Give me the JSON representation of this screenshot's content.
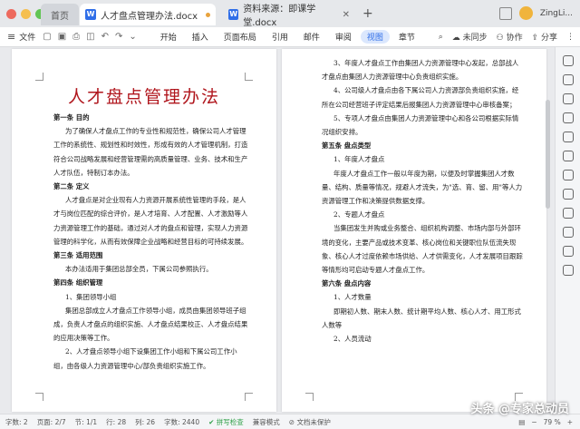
{
  "titlebar": {
    "home_tab": "首页",
    "doc_tab_active": "人才盘点管理办法.docx",
    "doc_tab_2": "资料来源：即课学堂.docx",
    "user": "ZingLi..."
  },
  "menubar": {
    "file": "文件",
    "items": [
      "开始",
      "插入",
      "页面布局",
      "引用",
      "邮件",
      "审阅",
      "视图",
      "章节"
    ],
    "active": "视图",
    "unsynced": "未同步",
    "collab": "协作",
    "share": "分享"
  },
  "page1": {
    "title": "人才盘点管理办法",
    "lines": [
      {
        "t": "第一条 目的",
        "k": "h"
      },
      {
        "t": "为了确保人才盘点工作的专业性和规范性，确保公司人才管理工作的系统性、规划性和时效性，形成有效的人才管理机制，打造符合公司战略发展和经营管理需的高质量管理、业务、技术和生产人才队伍，特制订本办法。",
        "k": "pi"
      },
      {
        "t": "第二条 定义",
        "k": "h"
      },
      {
        "t": "人才盘点是对企业现有人力资源开展系统性管理的手段，是人才与岗位匹配的综合评价，是人才培育、人才配置、人才激励等人力资源管理工作的基础，通过对人才的盘点和管理，实现人力资源管理的科学化，从而有效保障企业战略和经营目标的可持续发展。",
        "k": "pi"
      },
      {
        "t": "第三条 适用范围",
        "k": "h"
      },
      {
        "t": "本办法适用于集团总部全员，下属公司参照执行。",
        "k": "pi"
      },
      {
        "t": "第四条 组织管理",
        "k": "h"
      },
      {
        "t": "1、集团领导小组",
        "k": "li"
      },
      {
        "t": "集团总部成立人才盘点工作领导小组，成员由集团领导班子组成，负责人才盘点的组织实施、人才盘点结果校正、人才盘点结果的应用决策等工作。",
        "k": "pi"
      },
      {
        "t": "2、人才盘点领导小组下设集团工作小组和下属公司工作小组，由各级人力资源管理中心/部负责组织实施工作。",
        "k": "pi"
      }
    ]
  },
  "page2": {
    "lines": [
      {
        "t": "3、年度人才盘点工作由集团人力资源管理中心发起，总部战人才盘点由集团人力资源管理中心负责组织实施。",
        "k": "pi"
      },
      {
        "t": "4、公司级人才盘点由各下属公司人力资源部负责组织实施，经所在公司经营班子评定结果后报集团人力资源管理中心审核备案；",
        "k": "pi"
      },
      {
        "t": "5、专项人才盘点由集团人力资源管理中心和各公司根据实际情况组织安排。",
        "k": "pi"
      },
      {
        "t": "第五条 盘点类型",
        "k": "h"
      },
      {
        "t": "1、年度人才盘点",
        "k": "li"
      },
      {
        "t": "年度人才盘点工作一般以年度为期，以便及时掌握集团人才数量、结构、质量等情况，规避人才流失，为\"选、育、留、用\"等人力资源管理工作和决策提供数据支撑。",
        "k": "pi"
      },
      {
        "t": "2、专题人才盘点",
        "k": "li"
      },
      {
        "t": "当集团发生并购或业务整合、组织机构调整、市场内部与外部环境的变化，主要产品或技术变革、核心岗位和关键职位队伍流失现象、核心人才过度依赖市场供给、人才供需变化，人才发展项目跟踪等情形均可启动专题人才盘点工作。",
        "k": "pi"
      },
      {
        "t": "第六条 盘点内容",
        "k": "h"
      },
      {
        "t": "1、人才数量",
        "k": "li"
      },
      {
        "t": "即期初人数、期末人数、统计期平均人数、核心人才、用工形式人数等",
        "k": "pi"
      },
      {
        "t": "2、人员流动",
        "k": "li"
      }
    ]
  },
  "status": {
    "words": "字数: 2",
    "page": "页面: 2/7",
    "line": "节: 1/1",
    "row": "行: 28",
    "col": "列: 26",
    "count": "字数: 2440",
    "spell": "拼写检查",
    "compat": "兼容模式",
    "protect": "文档未保护",
    "zoom": "79 %"
  },
  "watermark": "头条 @专家总动员",
  "colors": {
    "accent": "#2f6ee8",
    "title_red": "#b0161d"
  }
}
